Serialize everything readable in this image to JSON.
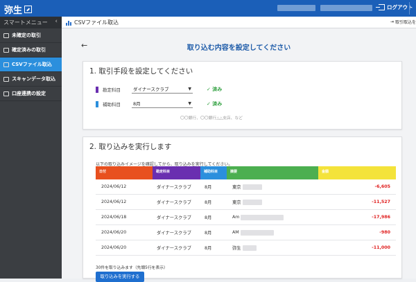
{
  "header": {
    "logo": "弥生",
    "logout_label": "ログアウト"
  },
  "sidebar": {
    "menu_label": "スマートメニュー",
    "items": [
      {
        "label": "未確定の取引"
      },
      {
        "label": "確定済みの取引"
      },
      {
        "label": "CSVファイル取込"
      },
      {
        "label": "スキャンデータ取込"
      },
      {
        "label": "口座連携の設定"
      }
    ]
  },
  "subheader": {
    "title": "CSVファイル取込",
    "right_label": "取引取込を"
  },
  "page": {
    "title": "取り込む内容を設定してください"
  },
  "section1": {
    "title": "1. 取引手段を設定してください",
    "rows": [
      {
        "label": "勘定科目",
        "value": "ダイナースクラブ",
        "status": "✓ 済み",
        "color": "#6a2fb0"
      },
      {
        "label": "補助科目",
        "value": "8月",
        "status": "✓ 済み",
        "color": "#2b8fdd"
      }
    ],
    "hint": "〇〇銀行、〇〇銀行△△支店、など"
  },
  "section2": {
    "title": "2. 取り込みを実行します",
    "description": "以下の取り込みイメージを確認してから、取り込みを実行してください。",
    "columns": [
      {
        "label": "日付",
        "color": "#e8501f"
      },
      {
        "label": "勘定科目",
        "color": "#6a2fb0"
      },
      {
        "label": "補助科目",
        "color": "#2b8fdd"
      },
      {
        "label": "摘要",
        "color": "#4caf50"
      },
      {
        "label": "金額",
        "color": "#f4e33a"
      }
    ],
    "rows": [
      {
        "date": "2024/06/12",
        "account": "ダイナースクラブ",
        "sub": "8月",
        "summary": "東京",
        "amount": "-6,605"
      },
      {
        "date": "2024/06/12",
        "account": "ダイナースクラブ",
        "sub": "8月",
        "summary": "東京",
        "amount": "-11,527"
      },
      {
        "date": "2024/06/18",
        "account": "ダイナースクラブ",
        "sub": "8月",
        "summary": "Am",
        "amount": "-17,986"
      },
      {
        "date": "2024/06/20",
        "account": "ダイナースクラブ",
        "sub": "8月",
        "summary": "AM",
        "amount": "-980"
      },
      {
        "date": "2024/06/20",
        "account": "ダイナースクラブ",
        "sub": "8月",
        "summary": "弥生",
        "amount": "-11,000"
      }
    ],
    "note": "30件を取り込みます（先頭5行を表示）",
    "exec_button": "取り込みを実行する"
  }
}
